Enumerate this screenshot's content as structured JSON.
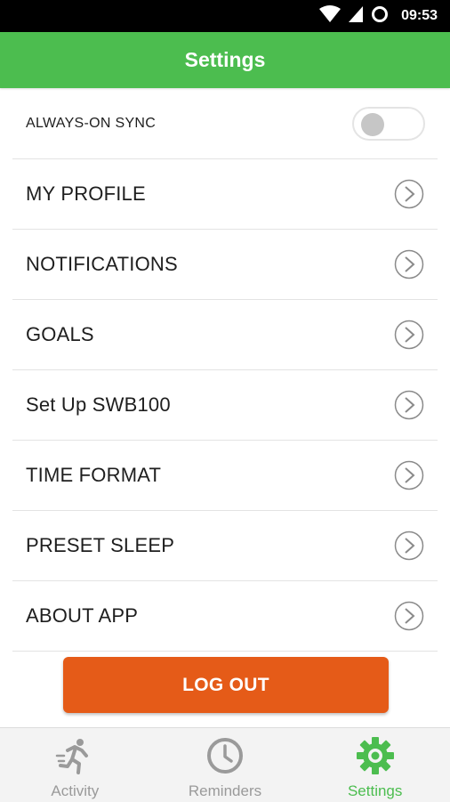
{
  "status_bar": {
    "time": "09:53",
    "icons": [
      "wifi-icon",
      "signal-icon",
      "loading-circle-icon"
    ]
  },
  "header": {
    "title": "Settings"
  },
  "sync": {
    "label": "ALWAYS-ON SYNC",
    "enabled": false
  },
  "menu": {
    "items": [
      {
        "label": "MY PROFILE"
      },
      {
        "label": "NOTIFICATIONS"
      },
      {
        "label": "GOALS"
      },
      {
        "label": "Set Up SWB100"
      },
      {
        "label": "TIME FORMAT"
      },
      {
        "label": "PRESET SLEEP"
      },
      {
        "label": "ABOUT APP"
      }
    ]
  },
  "logout": {
    "label": "LOG OUT"
  },
  "bottom_nav": {
    "items": [
      {
        "label": "Activity",
        "icon": "running-person-icon"
      },
      {
        "label": "Reminders",
        "icon": "clock-icon"
      },
      {
        "label": "Settings",
        "icon": "gear-icon",
        "active": true
      }
    ]
  },
  "colors": {
    "accent": "#4cbd4f",
    "logout": "#e55b18",
    "status_bar": "#000000"
  }
}
